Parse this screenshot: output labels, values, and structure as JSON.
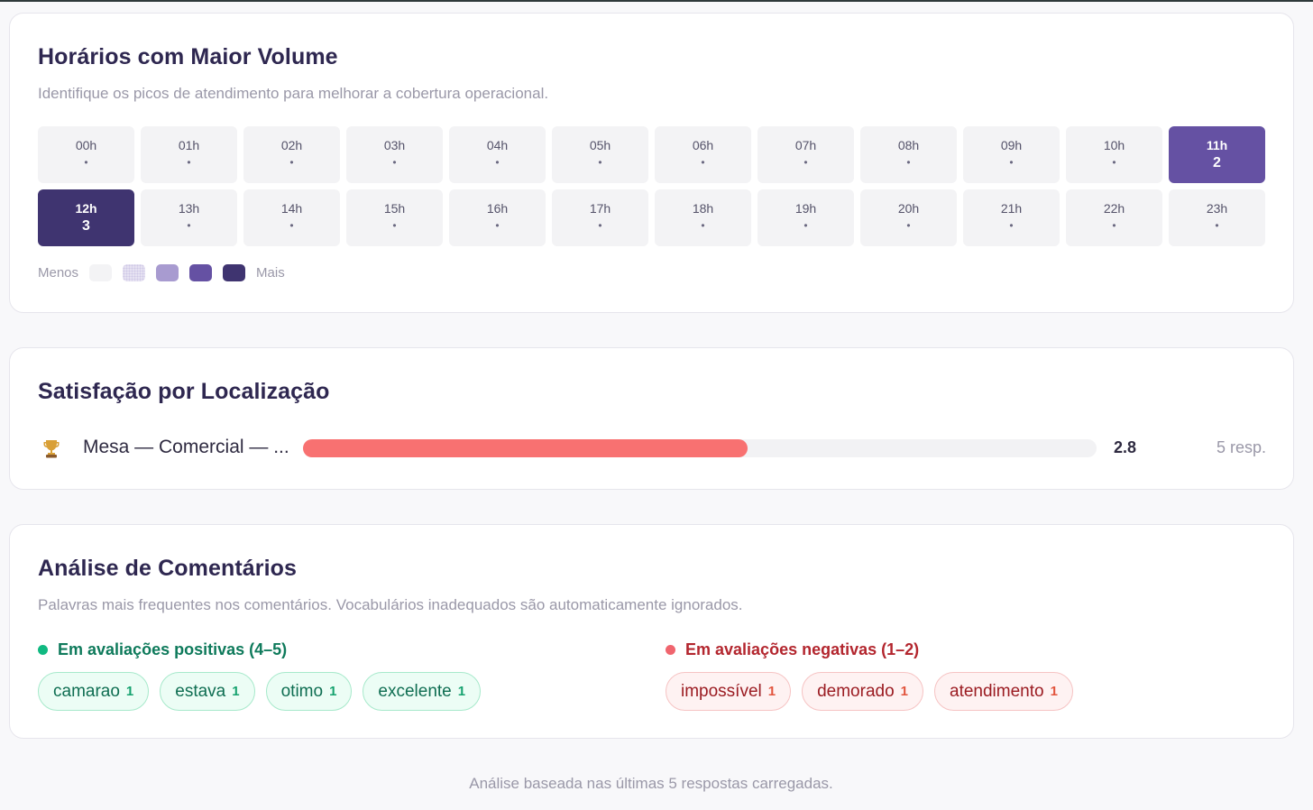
{
  "hours": {
    "title": "Horários com Maior Volume",
    "subtitle": "Identifique os picos de atendimento para melhorar a cobertura operacional.",
    "cells": [
      {
        "label": "00h",
        "value": "•",
        "level": 0
      },
      {
        "label": "01h",
        "value": "•",
        "level": 0
      },
      {
        "label": "02h",
        "value": "•",
        "level": 0
      },
      {
        "label": "03h",
        "value": "•",
        "level": 0
      },
      {
        "label": "04h",
        "value": "•",
        "level": 0
      },
      {
        "label": "05h",
        "value": "•",
        "level": 0
      },
      {
        "label": "06h",
        "value": "•",
        "level": 0
      },
      {
        "label": "07h",
        "value": "•",
        "level": 0
      },
      {
        "label": "08h",
        "value": "•",
        "level": 0
      },
      {
        "label": "09h",
        "value": "•",
        "level": 0
      },
      {
        "label": "10h",
        "value": "•",
        "level": 0
      },
      {
        "label": "11h",
        "value": "2",
        "level": 2
      },
      {
        "label": "12h",
        "value": "3",
        "level": 3
      },
      {
        "label": "13h",
        "value": "•",
        "level": 0
      },
      {
        "label": "14h",
        "value": "•",
        "level": 0
      },
      {
        "label": "15h",
        "value": "•",
        "level": 0
      },
      {
        "label": "16h",
        "value": "•",
        "level": 0
      },
      {
        "label": "17h",
        "value": "•",
        "level": 0
      },
      {
        "label": "18h",
        "value": "•",
        "level": 0
      },
      {
        "label": "19h",
        "value": "•",
        "level": 0
      },
      {
        "label": "20h",
        "value": "•",
        "level": 0
      },
      {
        "label": "21h",
        "value": "•",
        "level": 0
      },
      {
        "label": "22h",
        "value": "•",
        "level": 0
      },
      {
        "label": "23h",
        "value": "•",
        "level": 0
      }
    ],
    "legend": {
      "less_label": "Menos",
      "more_label": "Mais",
      "colors": [
        "#f3f3f5",
        "#e6e2f2",
        "#a89bd0",
        "#6551a3",
        "#3f3470"
      ]
    }
  },
  "location": {
    "title": "Satisfação por Localização",
    "rows": [
      {
        "icon": "trophy-icon",
        "name": "Mesa — Comercial — ...",
        "score": "2.8",
        "score_fraction": 0.56,
        "responses": "5 resp.",
        "bar_color": "#f87171"
      }
    ]
  },
  "comments": {
    "title": "Análise de Comentários",
    "subtitle": "Palavras mais frequentes nos comentários. Vocabulários inadequados são automaticamente ignorados.",
    "positive": {
      "heading": "Em avaliações positivas (4–5)",
      "words": [
        {
          "word": "camarao",
          "count": "1"
        },
        {
          "word": "estava",
          "count": "1"
        },
        {
          "word": "otimo",
          "count": "1"
        },
        {
          "word": "excelente",
          "count": "1"
        }
      ]
    },
    "negative": {
      "heading": "Em avaliações negativas (1–2)",
      "words": [
        {
          "word": "impossível",
          "count": "1"
        },
        {
          "word": "demorado",
          "count": "1"
        },
        {
          "word": "atendimento",
          "count": "1"
        }
      ]
    }
  },
  "footer": "Análise baseada nas últimas 5 respostas carregadas."
}
